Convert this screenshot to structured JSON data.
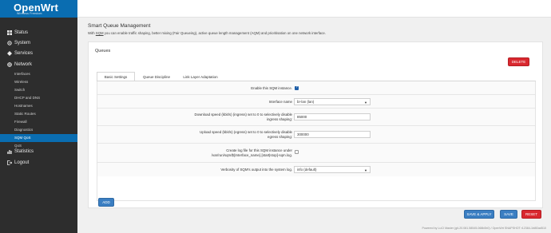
{
  "brand": {
    "name": "OpenWrt",
    "subtitle": "Wireless Freedom"
  },
  "sidebar": {
    "top_items": [
      {
        "label": "Status",
        "icon": "dashboard-icon"
      },
      {
        "label": "System",
        "icon": "gear-icon"
      },
      {
        "label": "Services",
        "icon": "services-icon"
      },
      {
        "label": "Network",
        "icon": "globe-icon"
      }
    ],
    "network_items": [
      "Interfaces",
      "Wireless",
      "Switch",
      "DHCP and DNS",
      "Hostnames",
      "Static Routes",
      "Firewall",
      "Diagnostics",
      "SQM QoS",
      "QoS"
    ],
    "active_item": "SQM QoS",
    "bottom_items": [
      {
        "label": "Statistics",
        "icon": "chart-icon"
      },
      {
        "label": "Logout",
        "icon": "logout-icon"
      }
    ]
  },
  "page": {
    "title": "Smart Queue Management",
    "desc_pre": "With ",
    "desc_link": "SQM",
    "desc_post": " you can enable traffic shaping, better mixing (Fair Queueing), active queue length management (AQM) and prioritisation on one network interface."
  },
  "queues": {
    "title": "Queues",
    "delete_label": "DELETE",
    "tabs": [
      "Basic Settings",
      "Queue Discipline",
      "Link Layer Adaptation"
    ],
    "active_tab": "Basic Settings",
    "fields": {
      "enable_label": "Enable this SQM instance.",
      "enable_checked": true,
      "interface_label": "Interface name",
      "interface_value": "br-lan (lan)",
      "download_label": "Download speed (kbit/s) (ingress) set to 0 to selectively disable ingress shaping:",
      "download_value": "85000",
      "upload_label": "Upload speed (kbit/s) (egress) set to 0 to selectively disable egress shaping:",
      "upload_value": "300000",
      "logfile_label": "Create log file for this SQM instance under /var/run/sqm/${Interface_name}.[start|stop]-sqm.log.",
      "logfile_checked": false,
      "verbosity_label": "Verbosity of SQM's output into the system log.",
      "verbosity_value": "info (default)"
    },
    "add_label": "ADD"
  },
  "footer": {
    "save_apply": "SAVE & APPLY",
    "save": "SAVE",
    "reset": "RESET",
    "powered_by": "Powered by LuCI Master (git-20.081.58545-068b0b0) / OpenWrt SNAPSHOT r12384-1b8f2ad510"
  },
  "colors": {
    "brand": "#0a6db1",
    "sidebar": "#2d2d2d",
    "danger": "#d9282f",
    "primary": "#3a7ec2"
  }
}
